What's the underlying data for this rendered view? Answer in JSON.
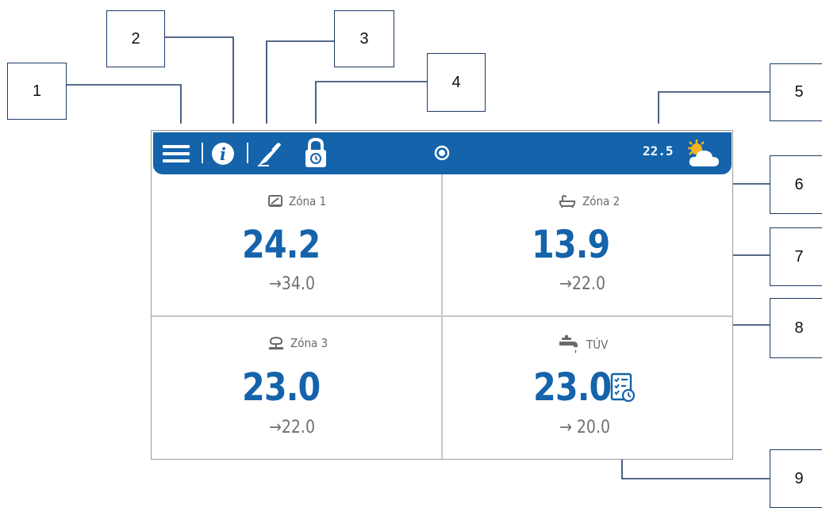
{
  "callouts": [
    "1",
    "2",
    "3",
    "4",
    "5",
    "6",
    "7",
    "8",
    "9"
  ],
  "topbar": {
    "outdoor_temp": "22.5",
    "menu_icon": "hamburger-menu-icon",
    "info_icon": "info-icon",
    "edit_icon": "pencil-icon",
    "lock_icon": "lock-icon",
    "weather_icon": "partly-sunny-icon",
    "status_icon": "radio-dot-icon",
    "color": "#1463ab"
  },
  "zones": [
    {
      "name": "Zóna 1",
      "icon": "floor-heating-icon",
      "temp": "24.2",
      "setpoint": "→34.0"
    },
    {
      "name": "Zóna 2",
      "icon": "bathtub-icon",
      "temp": "13.9",
      "setpoint": "→22.0"
    },
    {
      "name": "Zóna 3",
      "icon": "kitchen-icon",
      "temp": "23.0",
      "setpoint": "→22.0"
    },
    {
      "name": "TÚV",
      "icon": "faucet-icon",
      "temp": "23.0",
      "setpoint": "→ 20.0",
      "schedule_icon": "schedule-icon"
    }
  ]
}
